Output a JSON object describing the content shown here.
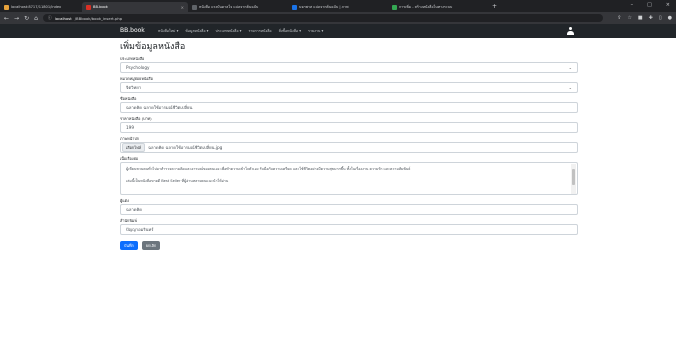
{
  "browser": {
    "tabs": [
      {
        "title": "localhost:8717/11801/index",
        "color": "#e8a33c",
        "active": false
      },
      {
        "title": "BB.book",
        "color": "#d93025",
        "active": true
      },
      {
        "title": "หนังสือ แรงบันดาลใจ แปลจากต้นฉบับ",
        "color": "#5f6368",
        "active": false
      },
      {
        "title": "บจกพาส แปลจากต้นฉบับ | ภาพ",
        "color": "#1a73e8",
        "active": false
      },
      {
        "title": "การเพิ่ม - สร้างหนังสือในทางระบบ",
        "color": "#34a853",
        "active": false
      }
    ],
    "url_host": "localhost",
    "url_path": "/BBbook/book_insert.php"
  },
  "navbar": {
    "brand": "BB.book",
    "menu": [
      "หนังสือใหม่ ▾",
      "ข้อมูลหนังสือ ▾",
      "ประเภทหนังสือ ▾",
      "รายการหนังสือ",
      "สั่งซื้อหนังสือ ▾",
      "รายงาน ▾"
    ]
  },
  "form": {
    "title": "เพิ่มข้อมูลหนังสือ",
    "category": {
      "label": "ประเภทหนังสือ",
      "value": "Psychology"
    },
    "subcategory": {
      "label": "หมวดหมู่ย่อยหนังสือ",
      "value": "จิตวิทยา"
    },
    "book_name": {
      "label": "ชื่อหนังสือ",
      "value": "ฉลาดคิด ฉลาดใช้อารมณ์ชีวิตเปลี่ยน"
    },
    "price": {
      "label": "ราคาหนังสือ (บาท)",
      "value": "199"
    },
    "cover": {
      "label": "ภาพหน้าปก",
      "button": "เลือกไฟล์",
      "filename": "ฉลาดคิด ฉลาดใช้อารมณ์ชีวิตเปลี่ยน.jpg"
    },
    "description": {
      "label": "เนื้อเรื่องย่อ",
      "paragraphs": [
        "ผู้เขียนชวนคนทั่วไปมาสำรวจความคิดและอารมณ์ของตนเอง เพื่อทำความเข้าใจตัวเอง รับมือกับความเครียด และใช้ชีวิตอย่างมีความสุขมากขึ้น ทั้งในเรื่องงาน ความรัก และความสัมพันธ์",
        "เล่มนี้เป็นหนังสือขายดี Best Seller ที่ผู้อ่านหลายคนแนะนำให้อ่าน"
      ]
    },
    "author": {
      "label": "ผู้แต่ง",
      "value": "ฉลาดคิด"
    },
    "publisher": {
      "label": "สำนักพิมพ์",
      "value": "ปัญญาอมรินทร์"
    },
    "buttons": {
      "save": "บันทึก",
      "cancel": "ยกเลิก"
    }
  }
}
